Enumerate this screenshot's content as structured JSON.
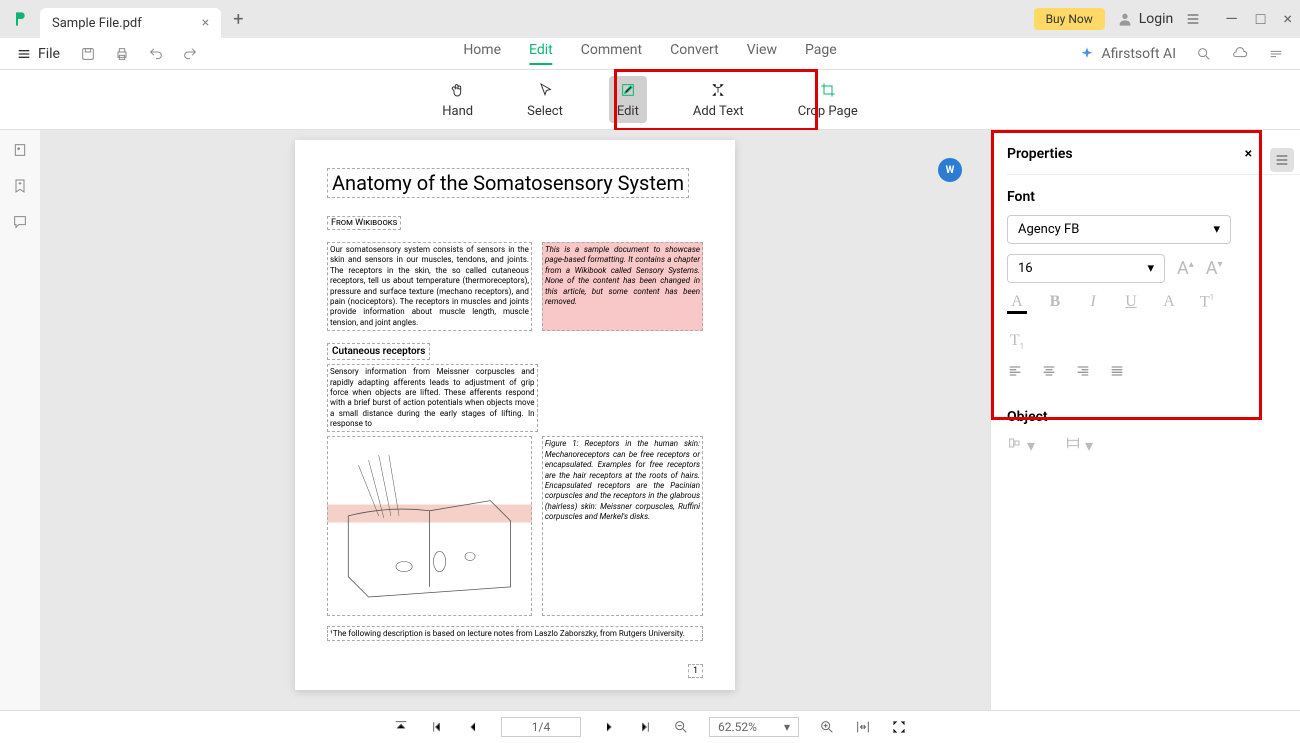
{
  "titlebar": {
    "tab_name": "Sample File.pdf",
    "buy_now": "Buy Now",
    "login": "Login"
  },
  "menubar": {
    "file": "File",
    "items": [
      "Home",
      "Edit",
      "Comment",
      "Convert",
      "View",
      "Page"
    ],
    "ai": "Afirstsoft AI"
  },
  "toolbar": {
    "hand": "Hand",
    "select": "Select",
    "edit": "Edit",
    "add_text": "Add Text",
    "crop_page": "Crop Page"
  },
  "properties": {
    "title": "Properties",
    "font_section": "Font",
    "font_name": "Agency FB",
    "font_size": "16",
    "object_section": "Object"
  },
  "document": {
    "title": "Anatomy of the Somatosensory System",
    "source": "From Wikibooks",
    "body_left": "Our somatosensory system consists of sensors in the skin and sensors in our muscles, tendons, and joints. The receptors in the skin, the so called cutaneous receptors, tell us about temperature (thermoreceptors), pressure and surface texture (mechano receptors), and pain (nociceptors). The receptors in muscles and joints provide information about muscle length, muscle tension, and joint angles.",
    "body_right": "This is a sample document to showcase page-based formatting. It contains a chapter from a Wikibook called Sensory Systems. None of the content has been changed in this article, but some content has been removed.",
    "section": "Cutaneous receptors",
    "section_body": "Sensory information from Meissner corpuscles and rapidly adapting afferents leads to adjustment of grip force when objects are lifted. These afferents respond with a brief burst of action potentials when objects move a small distance during the early stages of lifting. In response to",
    "figure_caption": "Figure 1: Receptors in the human skin: Mechanoreceptors can be free receptors or encapsulated. Examples for free receptors are the hair receptors at the roots of hairs. Encapsulated receptors are the Pacinian corpuscles and the receptors in the glabrous (hairless) skin: Meissner corpuscles, Ruffini corpuscles and Merkel's disks.",
    "footnote": "¹The following description is based on lecture notes from Laszlo Zaborszky, from Rutgers University.",
    "page_number": "1"
  },
  "statusbar": {
    "page": "1/4",
    "zoom": "62.52%"
  }
}
